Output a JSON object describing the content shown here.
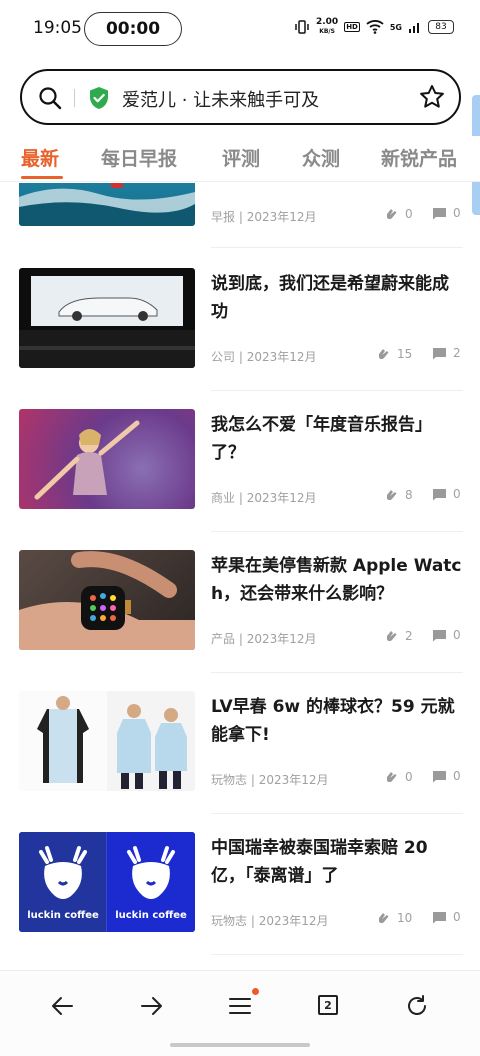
{
  "status": {
    "time": "19:05",
    "timer": "00:00",
    "speed_value": "2.00",
    "speed_unit": "KB/S",
    "hd": "HD",
    "network": "5G",
    "battery": "83"
  },
  "search": {
    "text": "爱范儿 · 让未来触手可及"
  },
  "tabs": [
    "最新",
    "每日早报",
    "评测",
    "众测",
    "新锐产品"
  ],
  "articles": [
    {
      "title": "",
      "category": "早报",
      "date": "2023年12月",
      "likes": "0",
      "comments": "0",
      "thumb": "surf"
    },
    {
      "title": "说到底，我们还是希望蔚来能成功",
      "category": "公司",
      "date": "2023年12月",
      "likes": "15",
      "comments": "2",
      "thumb": "car-stage"
    },
    {
      "title": "我怎么不爱「年度音乐报告」了？",
      "category": "商业",
      "date": "2023年12月",
      "likes": "8",
      "comments": "0",
      "thumb": "singer"
    },
    {
      "title": "苹果在美停售新款 Apple Watch，还会带来什么影响？",
      "category": "产品",
      "date": "2023年12月",
      "likes": "2",
      "comments": "0",
      "thumb": "watch"
    },
    {
      "title": "LV早春 6w 的棒球衣？59 元就能拿下!",
      "category": "玩物志",
      "date": "2023年12月",
      "likes": "0",
      "comments": "0",
      "thumb": "jackets"
    },
    {
      "title": "中国瑞幸被泰国瑞幸索赔 20 亿，「泰离谱」了",
      "category": "玩物志",
      "date": "2023年12月",
      "likes": "10",
      "comments": "0",
      "thumb": "luckin"
    }
  ],
  "thumb_text": {
    "luckin_left": "luckin coffee",
    "luckin_right": "luckin coffee"
  },
  "bottom_nav": {
    "tab_count": "2"
  },
  "colors": {
    "accent": "#e8622c",
    "badge": "#ef5a2a",
    "luckin_blue": "#1a2fa8"
  }
}
